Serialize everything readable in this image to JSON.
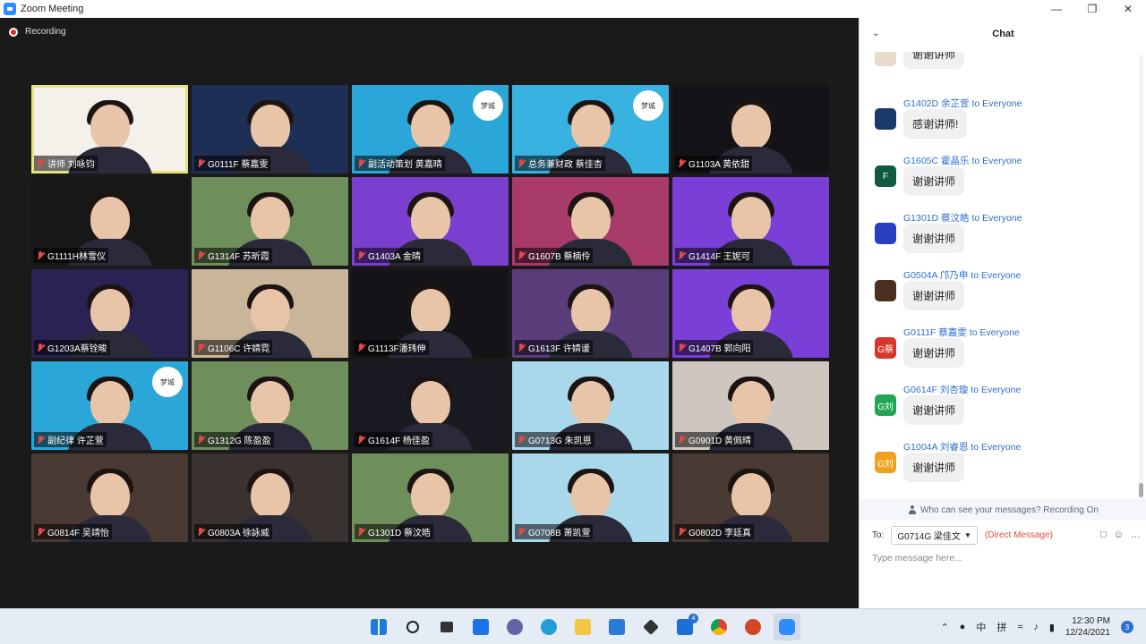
{
  "window": {
    "title": "Zoom Meeting"
  },
  "meeting": {
    "recording_label": "Recording"
  },
  "tiles": [
    {
      "name": "讲师 刘咏钧",
      "bg": "#f4f1ea",
      "badge": ""
    },
    {
      "name": "G0111F 蔡嘉雯",
      "bg": "#1e2f55",
      "badge": ""
    },
    {
      "name": "副活动策划 黄嘉晴",
      "bg": "#2aa7d8",
      "badge": "梦城"
    },
    {
      "name": "总务兼财政 蔡佳杏",
      "bg": "#38b2e0",
      "badge": "梦城"
    },
    {
      "name": "G1103A 黄依甜",
      "bg": "#141418",
      "badge": ""
    },
    {
      "name": "G1111H林雪仪",
      "bg": "#171717",
      "badge": ""
    },
    {
      "name": "G1314F 苏昕霞",
      "bg": "#6e8f5b",
      "badge": ""
    },
    {
      "name": "G1403A 金晴",
      "bg": "#7b3fd0",
      "badge": ""
    },
    {
      "name": "G1607B 蔡楠伶",
      "bg": "#a83b6a",
      "badge": ""
    },
    {
      "name": "G1414F 王妮可",
      "bg": "#7a3fd6",
      "badge": ""
    },
    {
      "name": "G1203A蔡铨畯",
      "bg": "#2a2352",
      "badge": ""
    },
    {
      "name": "G1106C 许婧霓",
      "bg": "#c9b59a",
      "badge": ""
    },
    {
      "name": "G1113F潘玮伸",
      "bg": "#141418",
      "badge": ""
    },
    {
      "name": "G1613F 许婧谖",
      "bg": "#5a3d7a",
      "badge": ""
    },
    {
      "name": "G1407B 郭向阳",
      "bg": "#7a3fd6",
      "badge": ""
    },
    {
      "name": "副纪律 许芷萱",
      "bg": "#2aa7d8",
      "badge": "梦城"
    },
    {
      "name": "G1312G 陈盈盈",
      "bg": "#6e8f5b",
      "badge": ""
    },
    {
      "name": "G1614F 杨佳盈",
      "bg": "#1a1a22",
      "badge": ""
    },
    {
      "name": "G0713G 朱凯恩",
      "bg": "#a8d8ea",
      "badge": ""
    },
    {
      "name": "G0901D 黄佩晴",
      "bg": "#cfc6bf",
      "badge": ""
    },
    {
      "name": "G0814F 吴靖怡",
      "bg": "#4a3a34",
      "badge": ""
    },
    {
      "name": "G0803A 徐詠威",
      "bg": "#3a3230",
      "badge": ""
    },
    {
      "name": "G1301D 蔡汶皓",
      "bg": "#6e8f5b",
      "badge": ""
    },
    {
      "name": "G0708B 萧凯萱",
      "bg": "#a8d8ea",
      "badge": ""
    },
    {
      "name": "G0802D 李廷真",
      "bg": "#4a3a34",
      "badge": ""
    }
  ],
  "chat": {
    "title": "Chat",
    "messages": [
      {
        "sender": "",
        "to": "",
        "text": "谢谢讲师",
        "avatar_text": "",
        "avatar_color": "#e6dccb"
      },
      {
        "sender": "G1402D 余芷萱",
        "to": "to Everyone",
        "text": "感谢讲师!",
        "avatar_text": "",
        "avatar_color": "#1b3a6b"
      },
      {
        "sender": "G1605C 霍晶乐",
        "to": "to Everyone",
        "text": "谢谢讲师",
        "avatar_text": "F",
        "avatar_color": "#0f5a43"
      },
      {
        "sender": "G1301D 蔡汶皓",
        "to": "to Everyone",
        "text": "谢谢讲师",
        "avatar_text": "",
        "avatar_color": "#2a3fbf"
      },
      {
        "sender": "G0504A 邝乃申",
        "to": "to Everyone",
        "text": "谢谢讲师",
        "avatar_text": "",
        "avatar_color": "#4a3020"
      },
      {
        "sender": "G0111F 蔡嘉雯",
        "to": "to Everyone",
        "text": "谢谢讲师",
        "avatar_text": "G蔡",
        "avatar_color": "#d8362a"
      },
      {
        "sender": "G0614F 刘杏璇",
        "to": "to Everyone",
        "text": "谢谢讲师",
        "avatar_text": "G刘",
        "avatar_color": "#22a654"
      },
      {
        "sender": "G1004A 刘睿恩",
        "to": "to Everyone",
        "text": "谢谢讲师",
        "avatar_text": "G刘",
        "avatar_color": "#f0a020"
      }
    ],
    "privacy_notice": "Who can see your messages? Recording On",
    "to_label": "To:",
    "recipient": "G0714G 梁佳文",
    "direct_message": "(Direct Message)",
    "input_placeholder": "Type message here..."
  },
  "tray": {
    "ime": "中",
    "ime2": "拼",
    "time": "12:30 PM",
    "date": "12/24/2021",
    "notifications": "3",
    "mail_count": "4"
  }
}
